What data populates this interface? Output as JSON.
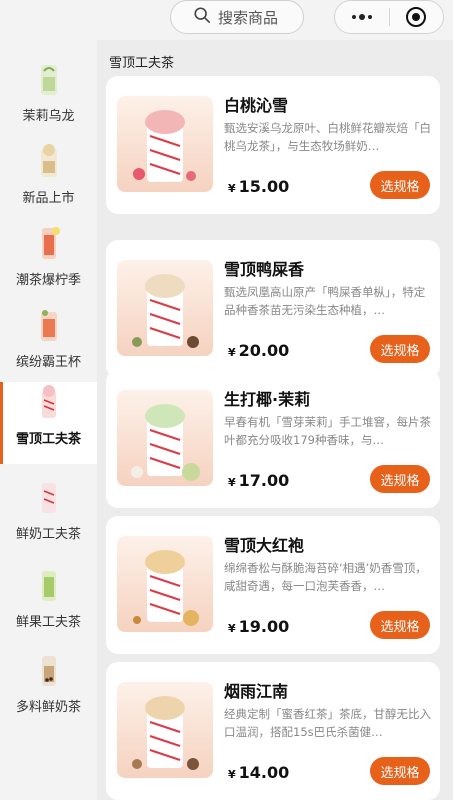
{
  "search": {
    "placeholder": "搜索商品"
  },
  "sidebar": {
    "items": [
      {
        "label": "茉莉乌龙",
        "color": "#dfe9c7"
      },
      {
        "label": "新品上市",
        "color": "#f1e6cf"
      },
      {
        "label": "潮茶爆柠季",
        "color": "#f6cdbc"
      },
      {
        "label": "缤纷霸王杯",
        "color": "#f7d2c2"
      },
      {
        "label": "雪顶工夫茶",
        "color": "#f5d3d0",
        "active": true
      },
      {
        "label": "鲜奶工夫茶",
        "color": "#f6dde0"
      },
      {
        "label": "鲜果工夫茶",
        "color": "#dbe9b8"
      },
      {
        "label": "多料鲜奶茶",
        "color": "#e8d8c2"
      }
    ]
  },
  "section": {
    "title": "雪顶工夫茶"
  },
  "products": [
    {
      "name": "白桃沁雪",
      "desc": "甄选安溪乌龙原叶、白桃鲜花瓣炭焙「白桃乌龙茶」，与生态牧场鲜奶…",
      "currency": "¥",
      "price": "15.00",
      "button": "选规格",
      "topping": "#f2b3b0"
    },
    {
      "name": "雪顶鸭屎香",
      "desc": "甄选凤凰高山原产「鸭屎香单枞」，特定品种香茶苗无污染生态种植，…",
      "currency": "¥",
      "price": "20.00",
      "button": "选规格",
      "topping": "#e8d2a8"
    },
    {
      "name": "生打椰·茉莉",
      "desc": "早春有机「雪芽茉莉」手工堆窨，每片茶叶都充分吸收179种香味，与…",
      "currency": "¥",
      "price": "17.00",
      "button": "选规格",
      "topping": "#cfe3b3"
    },
    {
      "name": "雪顶大红袍",
      "desc": "绵绵香松与酥脆海苔碎‘相遇’奶香雪顶，咸甜奇遇，每一口泡芙香香，…",
      "currency": "¥",
      "price": "19.00",
      "button": "选规格",
      "topping": "#ecc68e"
    },
    {
      "name": "烟雨江南",
      "desc": "经典定制「蜜香红茶」茶底，甘醇无比入口温润，搭配15s巴氏杀菌健…",
      "currency": "¥",
      "price": "14.00",
      "button": "选规格",
      "topping": "#e6c9a0"
    }
  ]
}
